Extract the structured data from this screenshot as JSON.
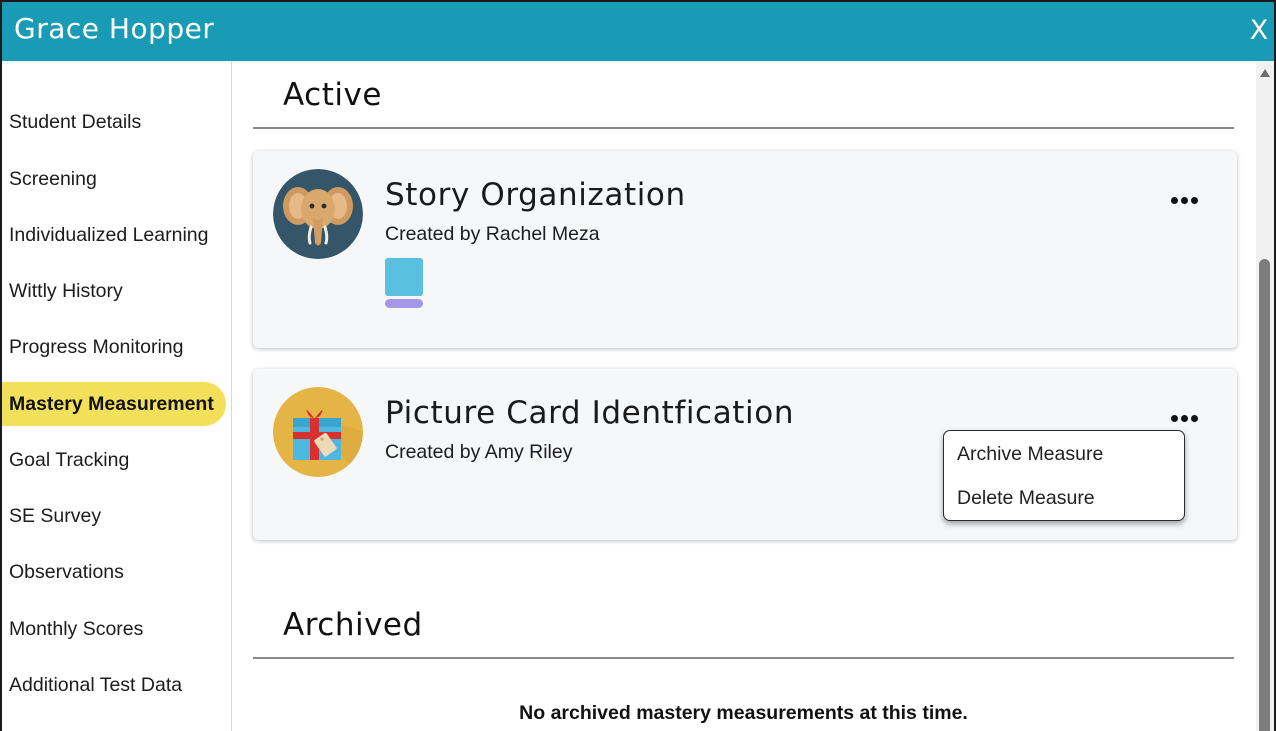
{
  "window": {
    "title": "Grace Hopper",
    "close_label": "X"
  },
  "sidebar": {
    "items": [
      {
        "label": "Student Details"
      },
      {
        "label": "Screening"
      },
      {
        "label": "Individualized Learning"
      },
      {
        "label": "Wittly History"
      },
      {
        "label": "Progress Monitoring"
      },
      {
        "label": "Mastery Measurement",
        "active": true
      },
      {
        "label": "Goal Tracking"
      },
      {
        "label": "SE Survey"
      },
      {
        "label": "Observations"
      },
      {
        "label": "Monthly Scores"
      },
      {
        "label": "Additional Test Data"
      }
    ]
  },
  "main": {
    "active_heading": "Active",
    "archived_heading": "Archived",
    "measures": [
      {
        "title": "Story Organization",
        "created_by": "Created by Rachel Meza",
        "icon": "elephant-icon"
      },
      {
        "title": "Picture Card Identfication",
        "created_by": "Created by Amy Riley",
        "icon": "gift-icon"
      }
    ],
    "context_menu": {
      "items": [
        {
          "label": "Archive Measure"
        },
        {
          "label": "Delete Measure"
        }
      ]
    },
    "archived_empty": "No archived mastery measurements at this time."
  },
  "colors": {
    "header": "#1a9bb5",
    "active_nav": "#f2e05a",
    "card_bg": "#f6f7f9",
    "tag_blue": "#5bbfe0",
    "tag_purple": "#a596e8"
  }
}
